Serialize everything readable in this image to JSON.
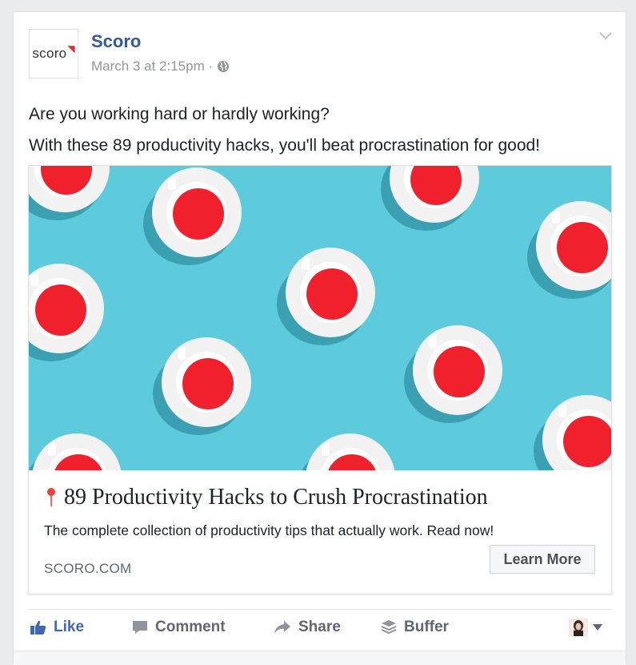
{
  "post": {
    "page_name": "Scoro",
    "avatar_text": "scoro",
    "timestamp": "March 3 at 2:15pm ·",
    "icons": {
      "privacy": "globe-icon",
      "menu": "chevron-down-icon"
    },
    "text_line1": "Are you working hard or hardly working?",
    "text_line2": "With these 89 productivity hacks, you'll beat procrastination for good!"
  },
  "link": {
    "image": "teacups-on-blue-image",
    "title": "89 Productivity Hacks to Crush Procrastination",
    "title_icon": "pin-icon",
    "description": "The complete collection of productivity tips that actually work. Read now!",
    "domain": "SCORO.COM",
    "cta": "Learn More"
  },
  "actions": {
    "like": "Like",
    "comment": "Comment",
    "share": "Share",
    "buffer": "Buffer",
    "icons": [
      "thumbs-up-icon",
      "comment-icon",
      "share-icon",
      "buffer-icon",
      "caret-down-icon"
    ]
  },
  "colors": {
    "link_blue": "#365899",
    "like_blue": "#4267b2",
    "image_bg": "#5ecbdc",
    "cup_red": "#f0212d"
  }
}
